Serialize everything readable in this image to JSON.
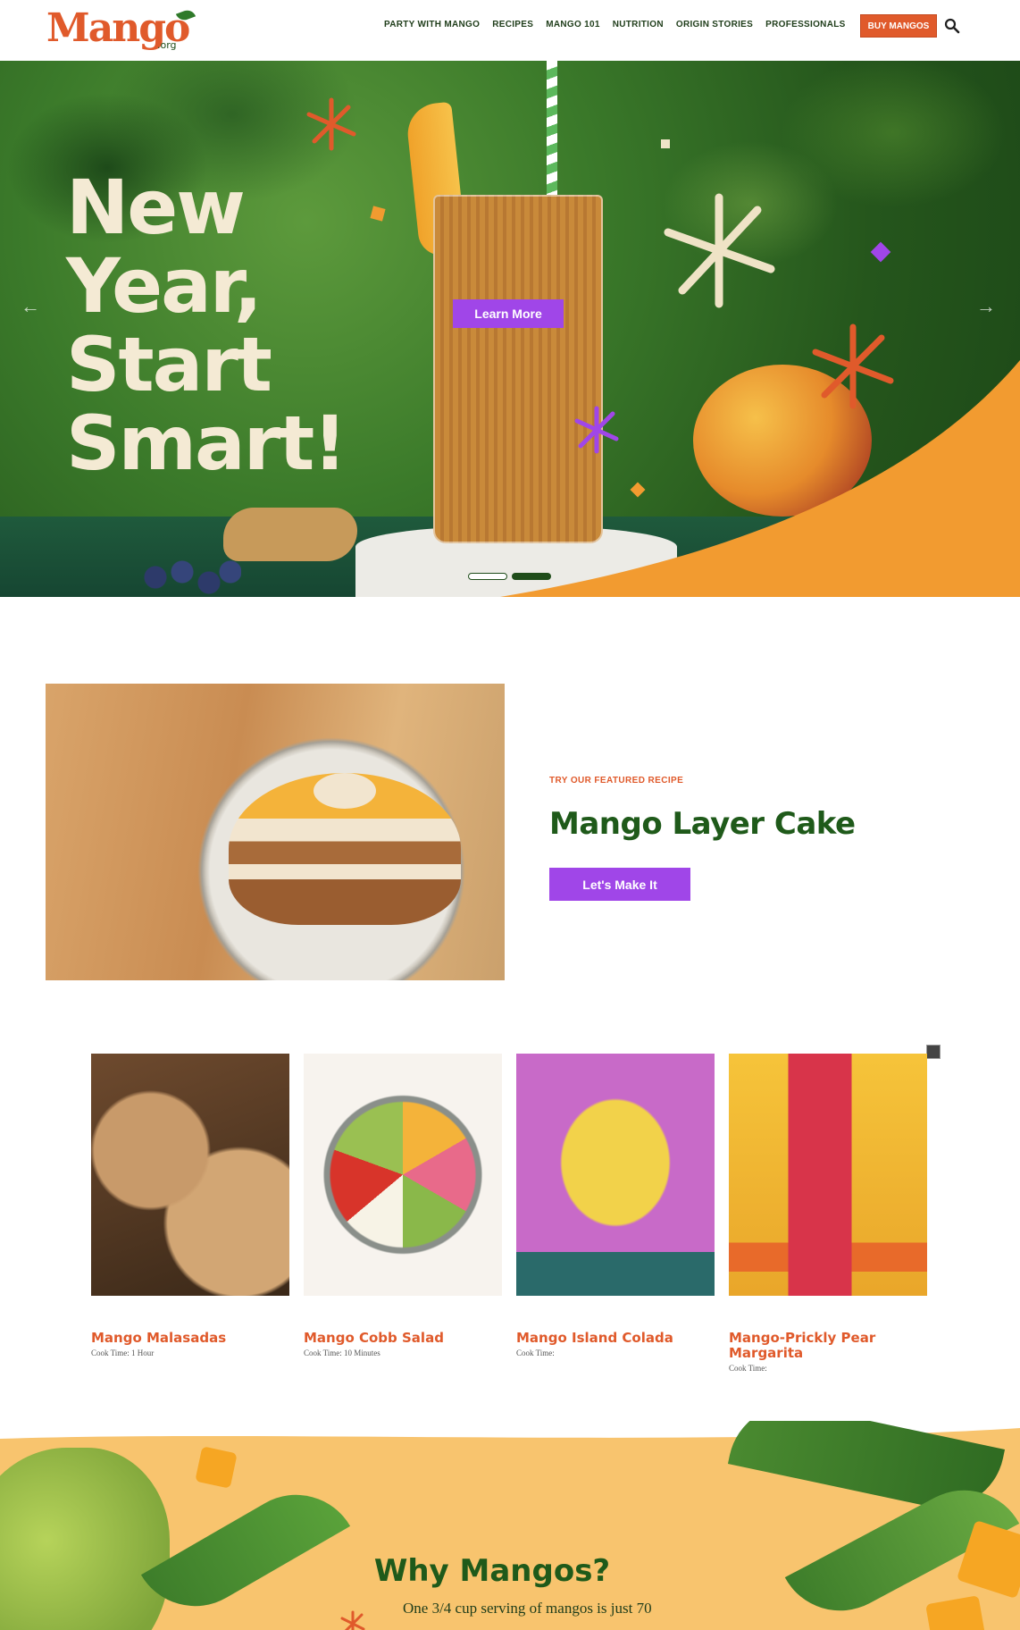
{
  "header": {
    "logo_text": "Mango",
    "logo_suffix": ".org",
    "nav": [
      "PARTY WITH MANGO",
      "RECIPES",
      "MANGO 101",
      "NUTRITION",
      "ORIGIN STORIES",
      "PROFESSIONALS"
    ],
    "buy_label": "BUY MANGOS",
    "search_icon": "search-icon"
  },
  "hero": {
    "title_lines": [
      "New",
      "Year,",
      "Start",
      "Smart!"
    ],
    "cta_label": "Learn More",
    "prev_icon": "chevron-left-icon",
    "next_icon": "chevron-right-icon",
    "slides_total": 2,
    "active_slide": 2
  },
  "featured": {
    "kicker": "TRY OUR FEATURED RECIPE",
    "title": "Mango Layer Cake",
    "cta_label": "Let's Make It"
  },
  "recipes": [
    {
      "title": "Mango Malasadas",
      "meta": "Cook Time: 1 Hour"
    },
    {
      "title": "Mango Cobb Salad",
      "meta": "Cook Time: 10 Minutes"
    },
    {
      "title": "Mango Island Colada",
      "meta": "Cook Time:"
    },
    {
      "title": "Mango-Prickly Pear Margarita",
      "meta": "Cook Time:"
    }
  ],
  "why": {
    "title": "Why Mangos?",
    "body": "One 3/4 cup serving of mangos is just 70"
  },
  "colors": {
    "brand_orange": "#e05a2b",
    "brand_green": "#1f5a1a",
    "accent_purple": "#a046e8",
    "hero_swoosh": "#f29b30",
    "why_background": "#f8c46e"
  }
}
